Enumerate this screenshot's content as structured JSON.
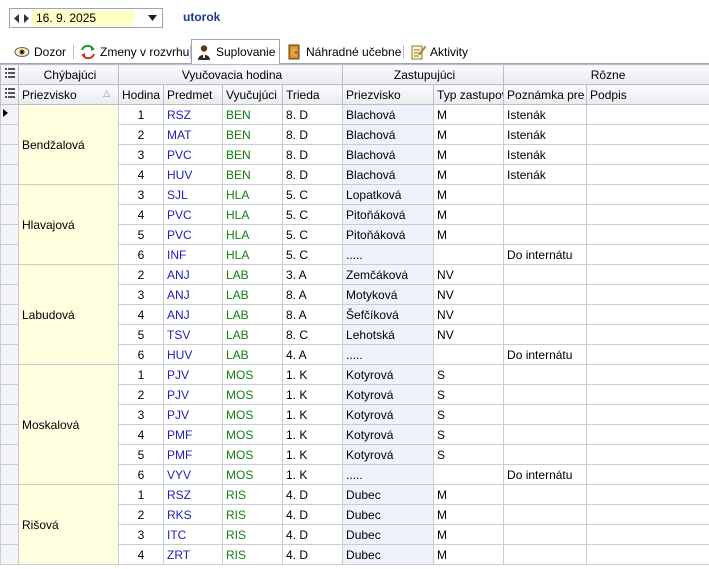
{
  "toolbar": {
    "date": "16. 9. 2025",
    "day": "utorok"
  },
  "tabs": [
    {
      "label": "Dozor",
      "icon": "eye-icon"
    },
    {
      "label": "Zmeny v rozvrhu",
      "icon": "swap-arrows-icon"
    },
    {
      "label": "Suplovanie",
      "icon": "person-icon"
    },
    {
      "label": "Náhradné učebne",
      "icon": "door-icon"
    },
    {
      "label": "Aktivity",
      "icon": "notepad-icon"
    }
  ],
  "active_tab": 2,
  "header": {
    "groups": {
      "chybajuci": "Chýbajúci",
      "vyucovacia": "Vyučovacia hodina",
      "zastupujuci": "Zastupujúci",
      "rozne": "Rôzne"
    },
    "cols": {
      "priezvisko": "Priezvisko",
      "hodina": "Hodina",
      "predmet": "Predmet",
      "vyucujuci": "Vyučujúci",
      "trieda": "Trieda",
      "zast_priezvisko": "Priezvisko",
      "typ": "Typ zastupov",
      "poznamka": "Poznámka pre",
      "podpis": "Podpis"
    }
  },
  "groups": [
    {
      "absent": "Bendžalová",
      "rows": [
        {
          "hod": "1",
          "pred": "RSZ",
          "vyuc": "BEN",
          "trieda": "8. D",
          "zast": "Blachová",
          "typ": "M",
          "pozn": "Istenák",
          "podpis": ""
        },
        {
          "hod": "2",
          "pred": "MAT",
          "vyuc": "BEN",
          "trieda": "8. D",
          "zast": "Blachová",
          "typ": "M",
          "pozn": "Istenák",
          "podpis": ""
        },
        {
          "hod": "3",
          "pred": "PVC",
          "vyuc": "BEN",
          "trieda": "8. D",
          "zast": "Blachová",
          "typ": "M",
          "pozn": "Istenák",
          "podpis": ""
        },
        {
          "hod": "4",
          "pred": "HUV",
          "vyuc": "BEN",
          "trieda": "8. D",
          "zast": "Blachová",
          "typ": "M",
          "pozn": "Istenák",
          "podpis": ""
        }
      ]
    },
    {
      "absent": "Hlavajová",
      "rows": [
        {
          "hod": "3",
          "pred": "SJL",
          "vyuc": "HLA",
          "trieda": "5. C",
          "zast": "Lopatková",
          "typ": "M",
          "pozn": "",
          "podpis": ""
        },
        {
          "hod": "4",
          "pred": "PVC",
          "vyuc": "HLA",
          "trieda": "5. C",
          "zast": "Pitoňáková",
          "typ": "M",
          "pozn": "",
          "podpis": ""
        },
        {
          "hod": "5",
          "pred": "PVC",
          "vyuc": "HLA",
          "trieda": "5. C",
          "zast": "Pitoňáková",
          "typ": "M",
          "pozn": "",
          "podpis": ""
        },
        {
          "hod": "6",
          "pred": "INF",
          "vyuc": "HLA",
          "trieda": "5. C",
          "zast": ".....",
          "typ": "",
          "pozn": "Do internátu",
          "podpis": ""
        }
      ]
    },
    {
      "absent": "Labudová",
      "rows": [
        {
          "hod": "2",
          "pred": "ANJ",
          "vyuc": "LAB",
          "trieda": "3. A",
          "zast": "Zemčáková",
          "typ": "NV",
          "pozn": "",
          "podpis": ""
        },
        {
          "hod": "3",
          "pred": "ANJ",
          "vyuc": "LAB",
          "trieda": "8. A",
          "zast": "Motyková",
          "typ": "NV",
          "pozn": "",
          "podpis": ""
        },
        {
          "hod": "4",
          "pred": "ANJ",
          "vyuc": "LAB",
          "trieda": "8. A",
          "zast": "Šefčíková",
          "typ": "NV",
          "pozn": "",
          "podpis": ""
        },
        {
          "hod": "5",
          "pred": "TSV",
          "vyuc": "LAB",
          "trieda": "8. C",
          "zast": "Lehotská",
          "typ": "NV",
          "pozn": "",
          "podpis": ""
        },
        {
          "hod": "6",
          "pred": "HUV",
          "vyuc": "LAB",
          "trieda": "4. A",
          "zast": ".....",
          "typ": "",
          "pozn": "Do internátu",
          "podpis": ""
        }
      ]
    },
    {
      "absent": "Moskalová",
      "rows": [
        {
          "hod": "1",
          "pred": "PJV",
          "vyuc": "MOS",
          "trieda": "1. K",
          "zast": "Kotyrová",
          "typ": "S",
          "pozn": "",
          "podpis": ""
        },
        {
          "hod": "2",
          "pred": "PJV",
          "vyuc": "MOS",
          "trieda": "1. K",
          "zast": "Kotyrová",
          "typ": "S",
          "pozn": "",
          "podpis": ""
        },
        {
          "hod": "3",
          "pred": "PJV",
          "vyuc": "MOS",
          "trieda": "1. K",
          "zast": "Kotyrová",
          "typ": "S",
          "pozn": "",
          "podpis": ""
        },
        {
          "hod": "4",
          "pred": "PMF",
          "vyuc": "MOS",
          "trieda": "1. K",
          "zast": "Kotyrová",
          "typ": "S",
          "pozn": "",
          "podpis": ""
        },
        {
          "hod": "5",
          "pred": "PMF",
          "vyuc": "MOS",
          "trieda": "1. K",
          "zast": "Kotyrová",
          "typ": "S",
          "pozn": "",
          "podpis": ""
        },
        {
          "hod": "6",
          "pred": "VYV",
          "vyuc": "MOS",
          "trieda": "1. K",
          "zast": ".....",
          "typ": "",
          "pozn": "Do internátu",
          "podpis": ""
        }
      ]
    },
    {
      "absent": "Rišová",
      "rows": [
        {
          "hod": "1",
          "pred": "RSZ",
          "vyuc": "RIS",
          "trieda": "4. D",
          "zast": "Dubec",
          "typ": "M",
          "pozn": "",
          "podpis": ""
        },
        {
          "hod": "2",
          "pred": "RKS",
          "vyuc": "RIS",
          "trieda": "4. D",
          "zast": "Dubec",
          "typ": "M",
          "pozn": "",
          "podpis": ""
        },
        {
          "hod": "3",
          "pred": "ITC",
          "vyuc": "RIS",
          "trieda": "4. D",
          "zast": "Dubec",
          "typ": "M",
          "pozn": "",
          "podpis": ""
        },
        {
          "hod": "4",
          "pred": "ZRT",
          "vyuc": "RIS",
          "trieda": "4. D",
          "zast": "Dubec",
          "typ": "M",
          "pozn": "",
          "podpis": ""
        }
      ]
    }
  ],
  "colors": {
    "subject": "#2020c0",
    "teacher": "#108010",
    "absent_bg": "#ffffe0",
    "date_bg": "#ffffc8",
    "day": "#1a3b8a"
  }
}
